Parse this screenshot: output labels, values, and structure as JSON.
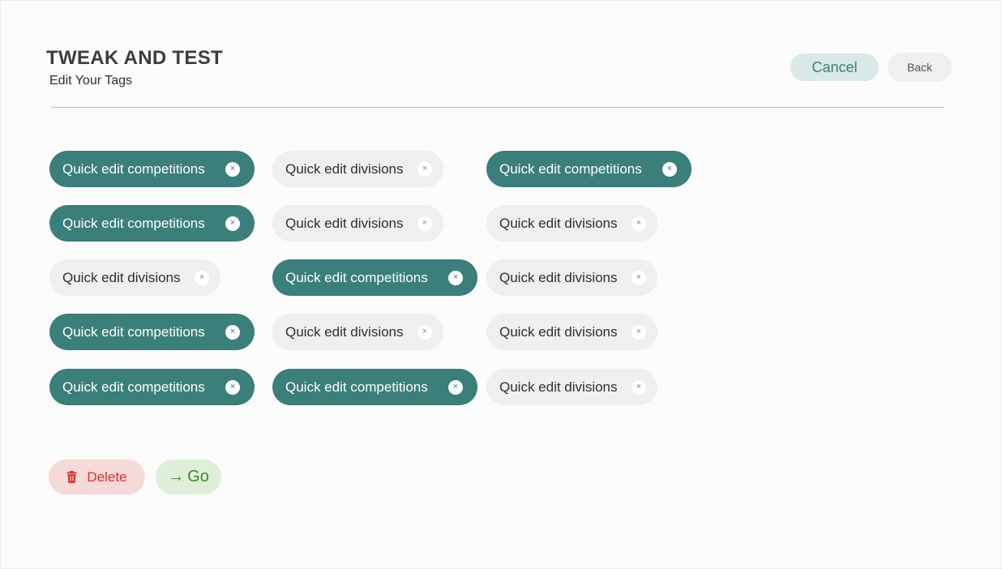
{
  "header": {
    "title": "TWEAK AND TEST",
    "subtitle": "Edit Your Tags",
    "cancel_label": "Cancel",
    "back_label": "Back"
  },
  "tags": {
    "c1": [
      {
        "label": "Quick edit competitions",
        "style": "dark",
        "remove_icon": "close-icon"
      },
      {
        "label": "Quick edit competitions",
        "style": "dark",
        "remove_icon": "close-icon"
      },
      {
        "label": "Quick edit divisions",
        "style": "light",
        "remove_icon": "close-icon"
      },
      {
        "label": "Quick edit competitions",
        "style": "dark",
        "remove_icon": "close-icon"
      },
      {
        "label": "Quick edit competitions",
        "style": "dark",
        "remove_icon": "close-icon"
      }
    ],
    "c2": [
      {
        "label": "Quick edit divisions",
        "style": "light",
        "remove_icon": "close-icon"
      },
      {
        "label": "Quick edit divisions",
        "style": "light",
        "remove_icon": "close-icon"
      },
      {
        "label": "Quick edit competitions",
        "style": "dark",
        "remove_icon": "close-icon"
      },
      {
        "label": "Quick edit divisions",
        "style": "light",
        "remove_icon": "close-icon"
      },
      {
        "label": "Quick edit competitions",
        "style": "dark",
        "remove_icon": "close-icon"
      }
    ],
    "c3": [
      {
        "label": "Quick edit competitions",
        "style": "dark",
        "remove_icon": "close-icon"
      },
      {
        "label": "Quick edit divisions",
        "style": "light",
        "remove_icon": "close-icon"
      },
      {
        "label": "Quick edit divisions",
        "style": "light",
        "remove_icon": "close-icon"
      },
      {
        "label": "Quick edit divisions",
        "style": "light",
        "remove_icon": "close-icon"
      },
      {
        "label": "Quick edit divisions",
        "style": "light",
        "remove_icon": "close-icon"
      }
    ],
    "remove_glyph": "×"
  },
  "actions": {
    "delete_label": "Delete",
    "delete_icon": "trash-icon",
    "go_arrow": "→",
    "go_label": "Go"
  },
  "colors": {
    "accent": "#3a7f79",
    "tag_light": "#efefef",
    "cancel_bg": "#d8e9e7",
    "delete_bg": "#f6d9d9",
    "delete_text": "#d6342b",
    "go_bg": "#dfeed9",
    "go_text": "#3c8a2a"
  }
}
